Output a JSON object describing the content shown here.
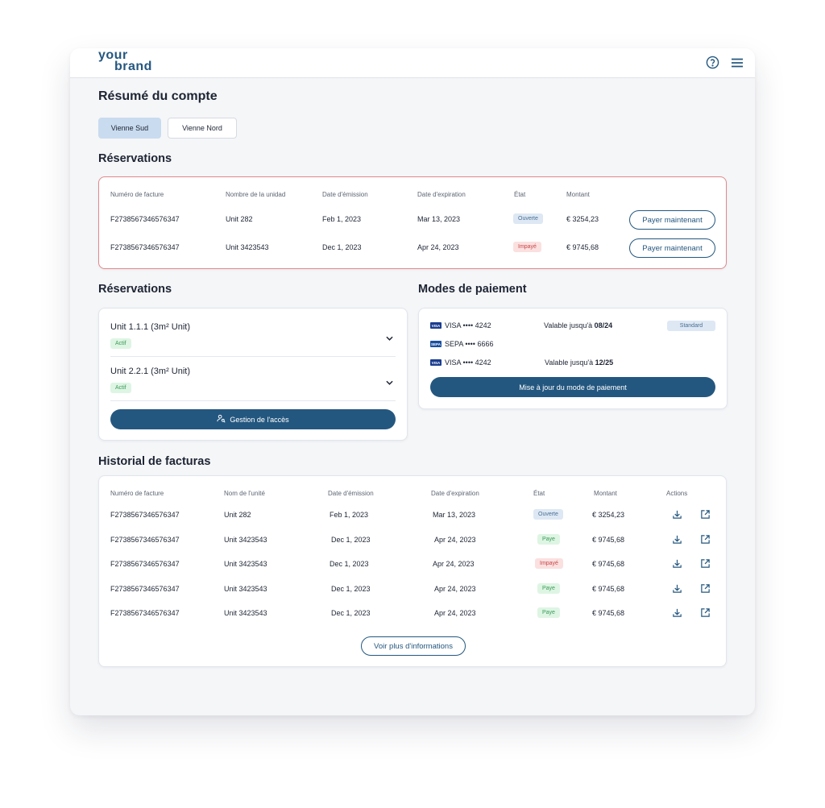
{
  "brand": {
    "line1": "your",
    "line2": "brand",
    "color": "#24577f"
  },
  "icons": {
    "help": "help-circle-icon",
    "menu": "hamburger-menu-icon",
    "download": "download-icon",
    "open": "external-link-icon",
    "chevron": "chevron-down-icon",
    "access": "users-key-icon"
  },
  "page_title": "Résumé du compte",
  "locations": [
    {
      "label": "Vienne Sud",
      "active": true
    },
    {
      "label": "Vienne Nord",
      "active": false
    }
  ],
  "reservations_table": {
    "title": "Réservations",
    "headers": [
      "Numéro de facture",
      "Nombre de la unidad",
      "Date d'émission",
      "Date d'expiration",
      "État",
      "Montant"
    ],
    "rows": [
      {
        "invoice": "F2738567346576347",
        "unit": "Unit 282",
        "issued": "Feb 1, 2023",
        "expires": "Mar 13, 2023",
        "status": "Ouverte",
        "amount": "€ 3254,23",
        "action": "Payer maintenant"
      },
      {
        "invoice": "F2738567346576347",
        "unit": "Unit 3423543",
        "issued": "Dec 1, 2023",
        "expires": "Apr 24, 2023",
        "status": "Impayé",
        "amount": "€ 9745,68",
        "action": "Payer maintenant"
      }
    ]
  },
  "units_section": {
    "title": "Réservations",
    "units": [
      {
        "name": "Unit 1.1.1 (3m² Unit)",
        "status": "Actif"
      },
      {
        "name": "Unit 2.2.1 (3m² Unit)",
        "status": "Actif"
      }
    ],
    "button": "Gestion de l'accès"
  },
  "payment_methods": {
    "title": "Modes de paiement",
    "methods": [
      {
        "logo": "VISA",
        "label": "VISA •••• 4242",
        "valid_prefix": "Valable jusqu'à ",
        "valid_date": "08/24",
        "badge": "Standard"
      },
      {
        "logo": "SEPA",
        "label": "SEPA •••• 6666",
        "valid_prefix": "",
        "valid_date": "",
        "badge": ""
      },
      {
        "logo": "VISA",
        "label": "VISA •••• 4242",
        "valid_prefix": "Valable jusqu'à ",
        "valid_date": "12/25",
        "badge": ""
      }
    ],
    "button": "Mise à jour du mode de paiement"
  },
  "history": {
    "title": "Historial de facturas",
    "headers": [
      "Numéro de facture",
      "Nom de l'unité",
      "Date d'émission",
      "Date d'expiration",
      "État",
      "Montant",
      "Actions"
    ],
    "rows": [
      {
        "invoice": "F2738567346576347",
        "unit": "Unit 282",
        "issued": "Feb 1, 2023",
        "expires": "Mar 13, 2023",
        "status": "Ouverte",
        "amount": "€ 3254,23"
      },
      {
        "invoice": "F2738567346576347",
        "unit": "Unit 3423543",
        "issued": "Dec 1, 2023",
        "expires": "Apr 24, 2023",
        "status": "Paye",
        "amount": "€ 9745,68"
      },
      {
        "invoice": "F2738567346576347",
        "unit": "Unit 3423543",
        "issued": "Dec 1, 2023",
        "expires": "Apr 24, 2023",
        "status": "Impayé",
        "amount": "€ 9745,68"
      },
      {
        "invoice": "F2738567346576347",
        "unit": "Unit 3423543",
        "issued": "Dec 1, 2023",
        "expires": "Apr 24, 2023",
        "status": "Paye",
        "amount": "€ 9745,68"
      },
      {
        "invoice": "F2738567346576347",
        "unit": "Unit 3423543",
        "issued": "Dec 1, 2023",
        "expires": "Apr 24, 2023",
        "status": "Paye",
        "amount": "€ 9745,68"
      }
    ],
    "more_button": "Voir plus d'informations"
  },
  "colors": {
    "primary": "#24577f",
    "accent_light": "#c9dbef",
    "danger_border": "#e0898c",
    "success": "#3c9a58",
    "danger": "#c84848"
  }
}
